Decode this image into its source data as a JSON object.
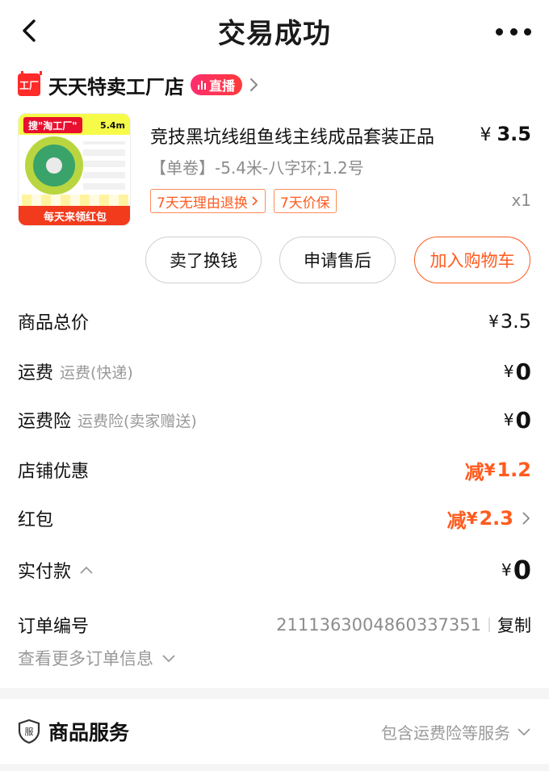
{
  "header": {
    "title": "交易成功",
    "back_icon": "chevron-left-icon",
    "more_icon": "more-dots-icon"
  },
  "shop": {
    "icon_text": "工厂",
    "name": "天天特卖工厂店",
    "live_badge": "直播"
  },
  "product": {
    "thumb": {
      "search_tag": "搜\"淘工厂\"",
      "length": "5.4m",
      "banner": "每天来领红包"
    },
    "title": "竞技黑坑线组鱼线主线成品套装正品",
    "price_symbol": "¥",
    "price": "3.5",
    "sku": "【单卷】-5.4米-八字环;1.2号",
    "tags": [
      "7天无理由退换",
      "7天价保"
    ],
    "quantity": "x1"
  },
  "actions": {
    "sell": "卖了换钱",
    "service": "申请售后",
    "cart": "加入购物车"
  },
  "summary": {
    "goods_total": {
      "label": "商品总价",
      "symbol": "¥",
      "value": "3.5"
    },
    "shipping": {
      "label": "运费",
      "sub": "运费(快递)",
      "symbol": "¥",
      "value": "0"
    },
    "shipping_insurance": {
      "label": "运费险",
      "sub": "运费险(卖家赠送)",
      "symbol": "¥",
      "value": "0"
    },
    "shop_discount": {
      "label": "店铺优惠",
      "prefix": "减",
      "symbol": "¥",
      "value": "1.2"
    },
    "red_packet": {
      "label": "红包",
      "prefix": "减",
      "symbol": "¥",
      "value": "2.3"
    },
    "paid": {
      "label": "实付款",
      "symbol": "¥",
      "value": "0"
    }
  },
  "order": {
    "label": "订单编号",
    "number": "2111363004860337351",
    "copy": "复制",
    "more_info": "查看更多订单信息"
  },
  "service": {
    "icon_text": "服",
    "title": "商品服务",
    "desc": "包含运费险等服务"
  },
  "colors": {
    "accent": "#ff5b1f",
    "shop_red": "#ff2a2a",
    "muted": "#999999"
  }
}
